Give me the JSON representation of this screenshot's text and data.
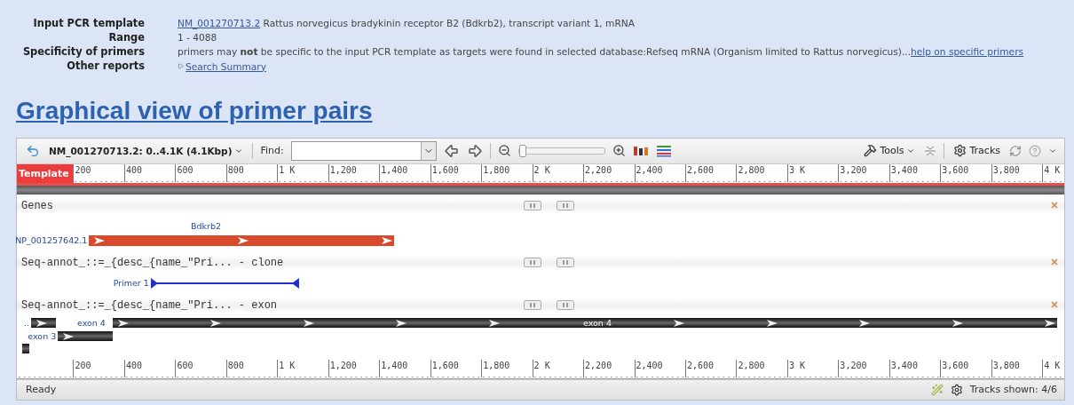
{
  "summary": {
    "rows": [
      {
        "label": "Input PCR template",
        "link": "NM_001270713.2",
        "text": " Rattus norvegicus bradykinin receptor B2 (Bdkrb2), transcript variant 1, mRNA"
      },
      {
        "label": "Range",
        "text": "1 - 4088"
      },
      {
        "label": "Specificity of primers",
        "text": "primers may **not** be specific to the input PCR template as targets were found in selected database:Refseq mRNA (Organism limited to Rattus norvegicus)...",
        "trailing_link": "help on specific primers"
      },
      {
        "label": "Other reports",
        "expander_link": "Search Summary"
      }
    ]
  },
  "heading": "Graphical view of primer pairs",
  "viewer": {
    "toolbar": {
      "sequence": "NM_001270713.2: 0..4.1K (4.1Kbp)",
      "find_label": "Find:",
      "zoom": {
        "level": 0.0
      },
      "tools": "Tools",
      "tracks": "Tracks"
    },
    "top_ruler": {
      "title": "Template",
      "ticks": [
        "200",
        "400",
        "600",
        "800",
        "1 K",
        "1,200",
        "1,400",
        "1,600",
        "1,800",
        "2 K",
        "2,200",
        "2,400",
        "2,600",
        "2,800",
        "3 K",
        "3,200",
        "3,400",
        "3,600",
        "3,800",
        "4 K"
      ]
    },
    "tracks": [
      {
        "kind": "gene",
        "title": "Genes",
        "features": [
          {
            "kind": "gene",
            "label": "Bdkrb2",
            "side_label": "NP_001257642.1"
          }
        ]
      },
      {
        "kind": "primer",
        "title": "Seq-annot_::=_{desc_{name_\"Pri... - clone",
        "features": [
          {
            "kind": "primer",
            "side_label": "Primer 1"
          }
        ]
      },
      {
        "kind": "exon",
        "title": "Seq-annot_::=_{desc_{name_\"Pri... - exon",
        "features": [
          {
            "kind": "exon",
            "side_label": ".."
          },
          {
            "kind": "exon",
            "side_label": "exon 4",
            "label": "exon 4"
          },
          {
            "kind": "exon",
            "side_label": "exon 3"
          },
          {
            "kind": "exon"
          }
        ]
      }
    ],
    "bottom_ruler": {
      "ticks": [
        "200",
        "400",
        "600",
        "800",
        "1 K",
        "1,200",
        "1,400",
        "1,600",
        "1,800",
        "2 K",
        "2,200",
        "2,400",
        "2,600",
        "2,800",
        "3 K",
        "3,200",
        "3,400",
        "3,600",
        "3,800",
        "4 K"
      ]
    },
    "status": {
      "text": "Ready",
      "tracks_shown": "Tracks shown: 4/6"
    }
  }
}
